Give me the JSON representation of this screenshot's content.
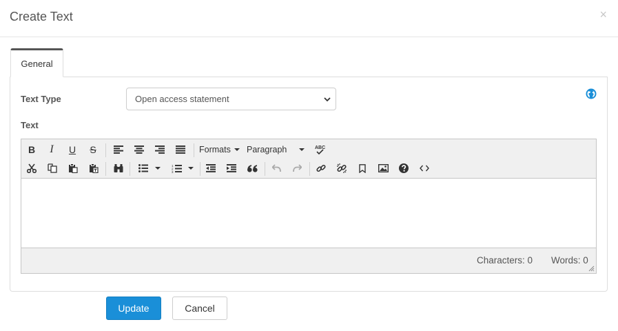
{
  "modal": {
    "title": "Create Text",
    "close_glyph": "×"
  },
  "tabs": [
    {
      "label": "General",
      "active": true
    }
  ],
  "form": {
    "text_type_label": "Text Type",
    "text_type_value": "Open access statement",
    "text_label": "Text",
    "info_icon": "globe-icon"
  },
  "editor": {
    "toolbar": {
      "formats_label": "Formats",
      "paragraph_label": "Paragraph",
      "bold": "B",
      "italic": "I",
      "underline": "U",
      "strikethrough": "S",
      "spellcheck": "ABC"
    },
    "status": {
      "characters": "Characters: 0",
      "words": "Words: 0"
    },
    "content": ""
  },
  "actions": {
    "update_label": "Update",
    "cancel_label": "Cancel"
  },
  "colors": {
    "primary": "#1a8fd8",
    "tab_accent": "#555555",
    "globe": "#1a8fd8"
  }
}
